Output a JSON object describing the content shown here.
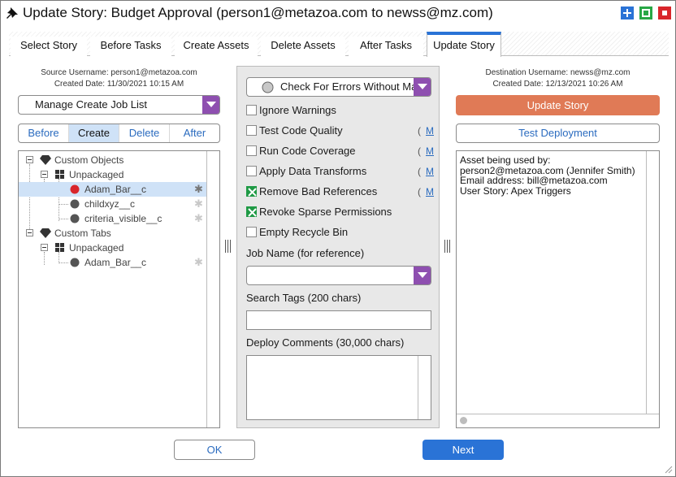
{
  "window": {
    "title": "Update Story: Budget Approval (person1@metazoa.com to newss@mz.com)",
    "controls": {
      "maximize_icon": "plus-icon",
      "restore_icon": "square-icon",
      "close_icon": "stop-icon"
    }
  },
  "tabs": [
    {
      "label": "Select Story",
      "active": false
    },
    {
      "label": "Before Tasks",
      "active": false
    },
    {
      "label": "Create Assets",
      "active": false
    },
    {
      "label": "Delete Assets",
      "active": false
    },
    {
      "label": "After Tasks",
      "active": false
    },
    {
      "label": "Update Story",
      "active": true
    }
  ],
  "source": {
    "username_line": "Source Username: person1@metazoa.com",
    "created_line": "Created Date: 11/30/2021 10:15 AM",
    "job_list_selected": "Manage Create Job List",
    "segments": [
      {
        "label": "Before",
        "active": false
      },
      {
        "label": "Create",
        "active": true
      },
      {
        "label": "Delete",
        "active": false
      },
      {
        "label": "After",
        "active": false
      }
    ],
    "tree": {
      "group1": {
        "label": "Custom Objects",
        "child": {
          "label": "Unpackaged",
          "items": [
            {
              "label": "Adam_Bar__c",
              "status": "red",
              "selected": true
            },
            {
              "label": "childxyz__c",
              "status": "gray",
              "selected": false
            },
            {
              "label": "criteria_visible__c",
              "status": "gray",
              "selected": false
            }
          ]
        }
      },
      "group2": {
        "label": "Custom Tabs",
        "child": {
          "label": "Unpackaged",
          "items": [
            {
              "label": "Adam_Bar__c",
              "status": "gray",
              "selected": false
            }
          ]
        }
      }
    }
  },
  "options": {
    "check_errors_selected": "Check For Errors Without Making Changes",
    "checkboxes": [
      {
        "label": "Ignore Warnings",
        "checked": false,
        "link": ""
      },
      {
        "label": "Test Code Quality",
        "checked": false,
        "link": "M"
      },
      {
        "label": "Run Code Coverage",
        "checked": false,
        "link": "M"
      },
      {
        "label": "Apply Data Transforms",
        "checked": false,
        "link": "M"
      },
      {
        "label": "Remove Bad References",
        "checked": true,
        "link": "M"
      },
      {
        "label": "Revoke Sparse Permissions",
        "checked": true,
        "link": ""
      },
      {
        "label": "Empty Recycle Bin",
        "checked": false,
        "link": ""
      }
    ],
    "link_open_paren": "(",
    "job_name_label": "Job Name (for reference)",
    "job_name_value": "",
    "search_tags_label": "Search Tags (200 chars)",
    "search_tags_value": "",
    "deploy_comments_label": "Deploy Comments (30,000 chars)",
    "deploy_comments_value": ""
  },
  "destination": {
    "username_line": "Destination Username: newss@mz.com",
    "created_line": "Created Date: 12/13/2021 10:26 AM",
    "update_button": "Update Story",
    "test_button": "Test Deployment",
    "info_text": "Asset being used by:\nperson2@metazoa.com (Jennifer Smith)\nEmail address: bill@metazoa.com\nUser Story: Apex Triggers"
  },
  "footer": {
    "ok": "OK",
    "next": "Next"
  },
  "colors": {
    "accent": "#2a73d6",
    "dropdown_arrow": "#8e4fb0",
    "update_button": "#e07a56",
    "checkbox_checked": "#1f9a45",
    "status_red": "#d9262b",
    "status_gray": "#555555",
    "close": "#d9262b",
    "restore": "#28a745"
  }
}
